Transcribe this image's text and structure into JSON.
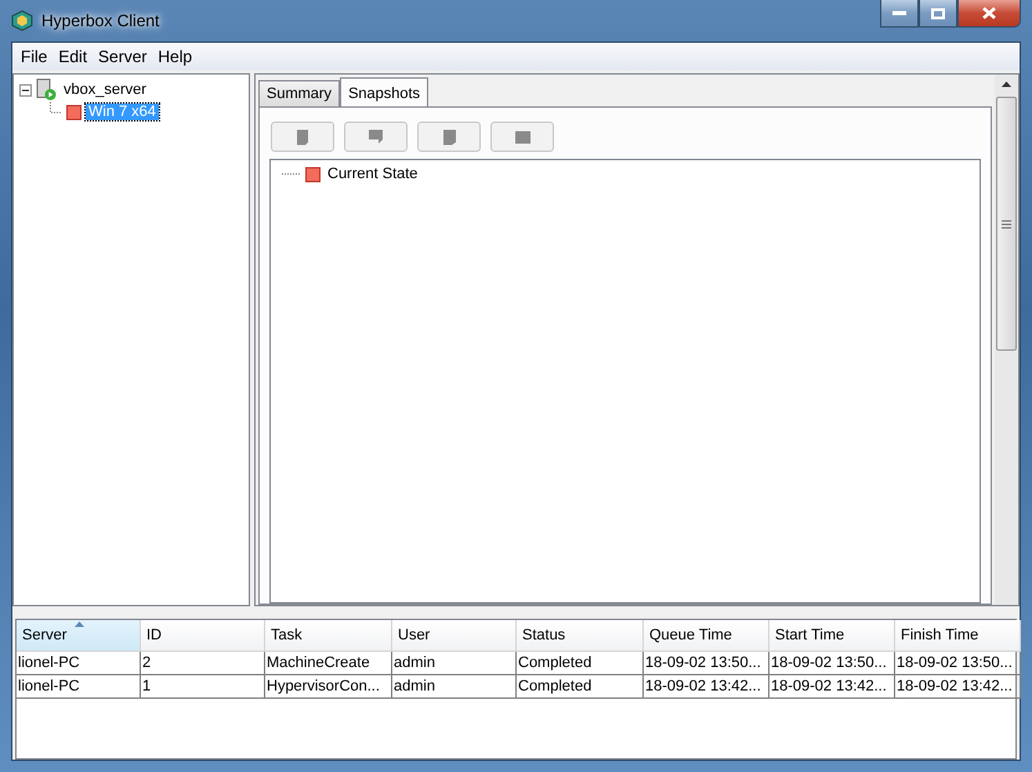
{
  "window": {
    "title": "Hyperbox Client"
  },
  "menu": [
    "File",
    "Edit",
    "Server",
    "Help"
  ],
  "tree": [
    {
      "label": "vbox_server",
      "kind": "server",
      "expanded": true,
      "selected": false,
      "children": [
        {
          "label": "Win 7 x64",
          "kind": "machine",
          "selected": true
        }
      ]
    }
  ],
  "tabs": [
    {
      "label": "Summary",
      "selected": false
    },
    {
      "label": "Snapshots",
      "selected": true
    }
  ],
  "toolbar": [
    {
      "disabled": true
    },
    {
      "disabled": true
    },
    {
      "disabled": true
    },
    {
      "disabled": true
    }
  ],
  "snapshots": [
    {
      "label": "Current State"
    }
  ],
  "table": {
    "columns": [
      "Server",
      "ID",
      "Task",
      "User",
      "Status",
      "Queue Time",
      "Start Time",
      "Finish Time"
    ],
    "rows": [
      [
        "lionel-PC",
        "2",
        "MachineCreate",
        "admin",
        "Completed",
        "18-09-02 13:50...",
        "18-09-02 13:50...",
        "18-09-02 13:50..."
      ],
      [
        "lionel-PC",
        "1",
        "HypervisorCon...",
        "admin",
        "Completed",
        "18-09-02 13:42...",
        "18-09-02 13:42...",
        "18-09-02 13:42..."
      ]
    ]
  }
}
